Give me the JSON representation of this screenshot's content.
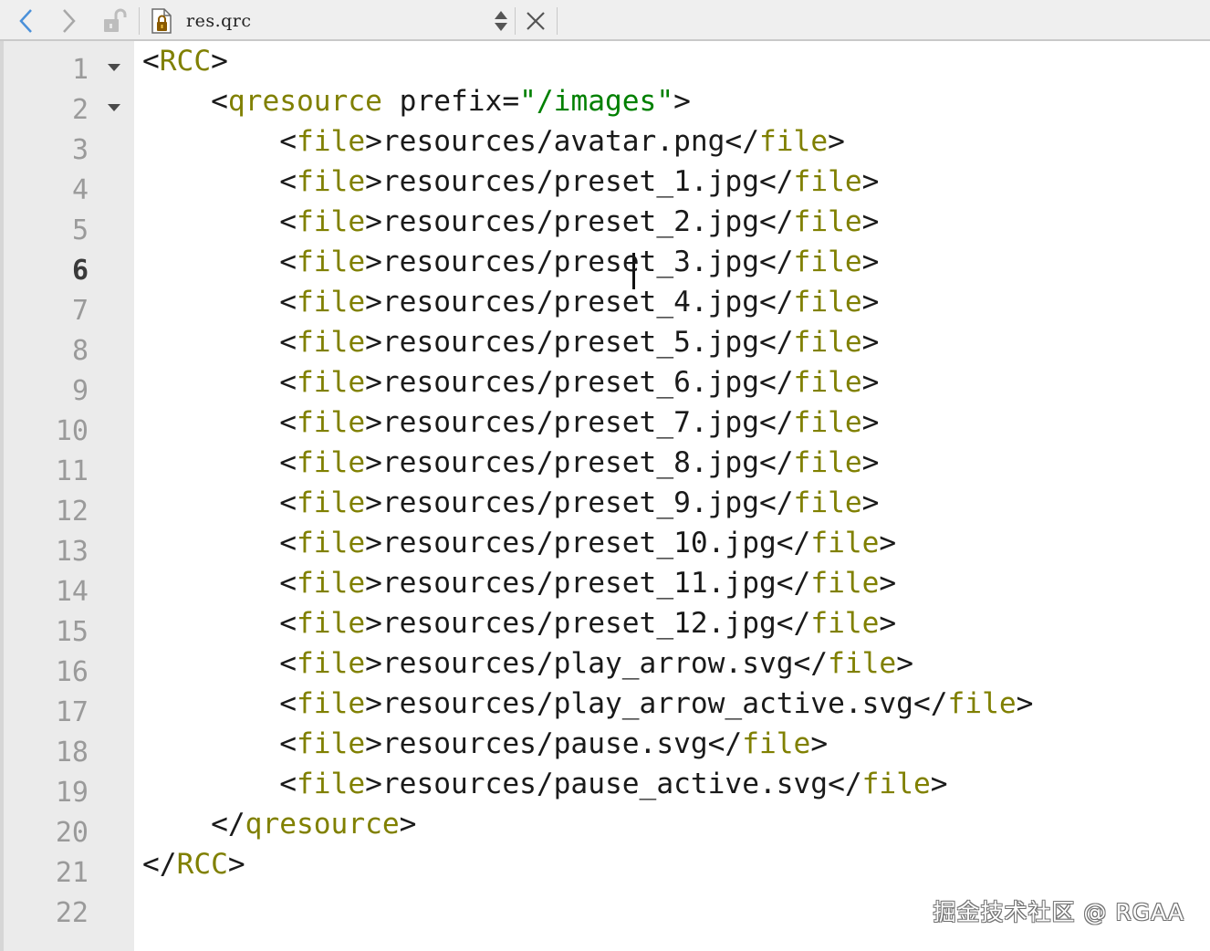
{
  "toolbar": {
    "file_name": "res.qrc",
    "icons": {
      "back": "chevron-left-icon",
      "forward": "chevron-right-icon",
      "lock": "unlock-icon",
      "file": "locked-file-icon",
      "switch": "up-down-arrows-icon",
      "close": "close-icon"
    }
  },
  "editor": {
    "current_line": 6,
    "line_numbers": [
      "1",
      "2",
      "3",
      "4",
      "5",
      "6",
      "7",
      "8",
      "9",
      "10",
      "11",
      "12",
      "13",
      "14",
      "15",
      "16",
      "17",
      "18",
      "19",
      "20",
      "21",
      "22"
    ],
    "lines": [
      {
        "indent": 0,
        "kind": "open",
        "tag": "RCC"
      },
      {
        "indent": 1,
        "kind": "open_attr",
        "tag": "qresource",
        "attr": "prefix",
        "value": "\"/images\""
      },
      {
        "indent": 2,
        "kind": "file",
        "text": "resources/avatar.png"
      },
      {
        "indent": 2,
        "kind": "file",
        "text": "resources/preset_1.jpg"
      },
      {
        "indent": 2,
        "kind": "file",
        "text": "resources/preset_2.jpg"
      },
      {
        "indent": 2,
        "kind": "file",
        "text": "resources/preset_3.jpg"
      },
      {
        "indent": 2,
        "kind": "file",
        "text": "resources/preset_4.jpg"
      },
      {
        "indent": 2,
        "kind": "file",
        "text": "resources/preset_5.jpg"
      },
      {
        "indent": 2,
        "kind": "file",
        "text": "resources/preset_6.jpg"
      },
      {
        "indent": 2,
        "kind": "file",
        "text": "resources/preset_7.jpg"
      },
      {
        "indent": 2,
        "kind": "file",
        "text": "resources/preset_8.jpg"
      },
      {
        "indent": 2,
        "kind": "file",
        "text": "resources/preset_9.jpg"
      },
      {
        "indent": 2,
        "kind": "file",
        "text": "resources/preset_10.jpg"
      },
      {
        "indent": 2,
        "kind": "file",
        "text": "resources/preset_11.jpg"
      },
      {
        "indent": 2,
        "kind": "file",
        "text": "resources/preset_12.jpg"
      },
      {
        "indent": 2,
        "kind": "file",
        "text": "resources/play_arrow.svg"
      },
      {
        "indent": 2,
        "kind": "file",
        "text": "resources/play_arrow_active.svg"
      },
      {
        "indent": 2,
        "kind": "file",
        "text": "resources/pause.svg"
      },
      {
        "indent": 2,
        "kind": "file",
        "text": "resources/pause_active.svg"
      },
      {
        "indent": 1,
        "kind": "close",
        "tag": "qresource"
      },
      {
        "indent": 0,
        "kind": "close",
        "tag": "RCC"
      },
      {
        "indent": 0,
        "kind": "empty"
      }
    ],
    "file_tag": "file"
  },
  "watermark": "掘金技术社区 @ RGAA",
  "colors": {
    "tag": "#808000",
    "string": "#008000",
    "text": "#1a1a1a",
    "gutter_bg": "#ebebeb",
    "line_number": "#9a9a9a",
    "current_line_number": "#3a3a3a",
    "toolbar_bg": "#efefef",
    "nav_icon": "#4a90d9"
  }
}
